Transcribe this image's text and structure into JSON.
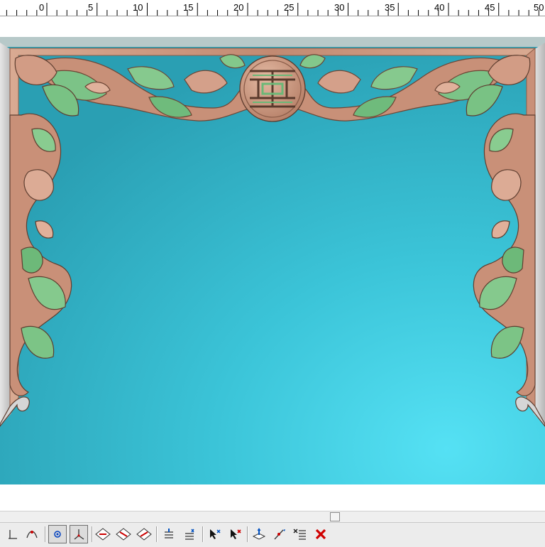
{
  "ruler": {
    "labels": [
      "0",
      "5",
      "10",
      "15",
      "20",
      "25",
      "30",
      "35",
      "40",
      "45",
      "50"
    ]
  },
  "viewport": {
    "content": "3D relief carving - door arch frame with scrolls and shou medallion",
    "colors": {
      "background": "#2fb3c9",
      "frame": "#c8947c",
      "leaf_green": "#78c081"
    }
  },
  "toolbar": {
    "icons": [
      "axis-icon",
      "curve-icon",
      "snap-point-icon",
      "snap-axis-icon",
      "view-front-icon",
      "view-top-icon",
      "view-iso-icon",
      "layer-down-icon",
      "layer-up-icon",
      "select-add-icon",
      "select-remove-icon",
      "move-icon",
      "pick-icon",
      "list-edit-icon",
      "delete-icon"
    ]
  }
}
